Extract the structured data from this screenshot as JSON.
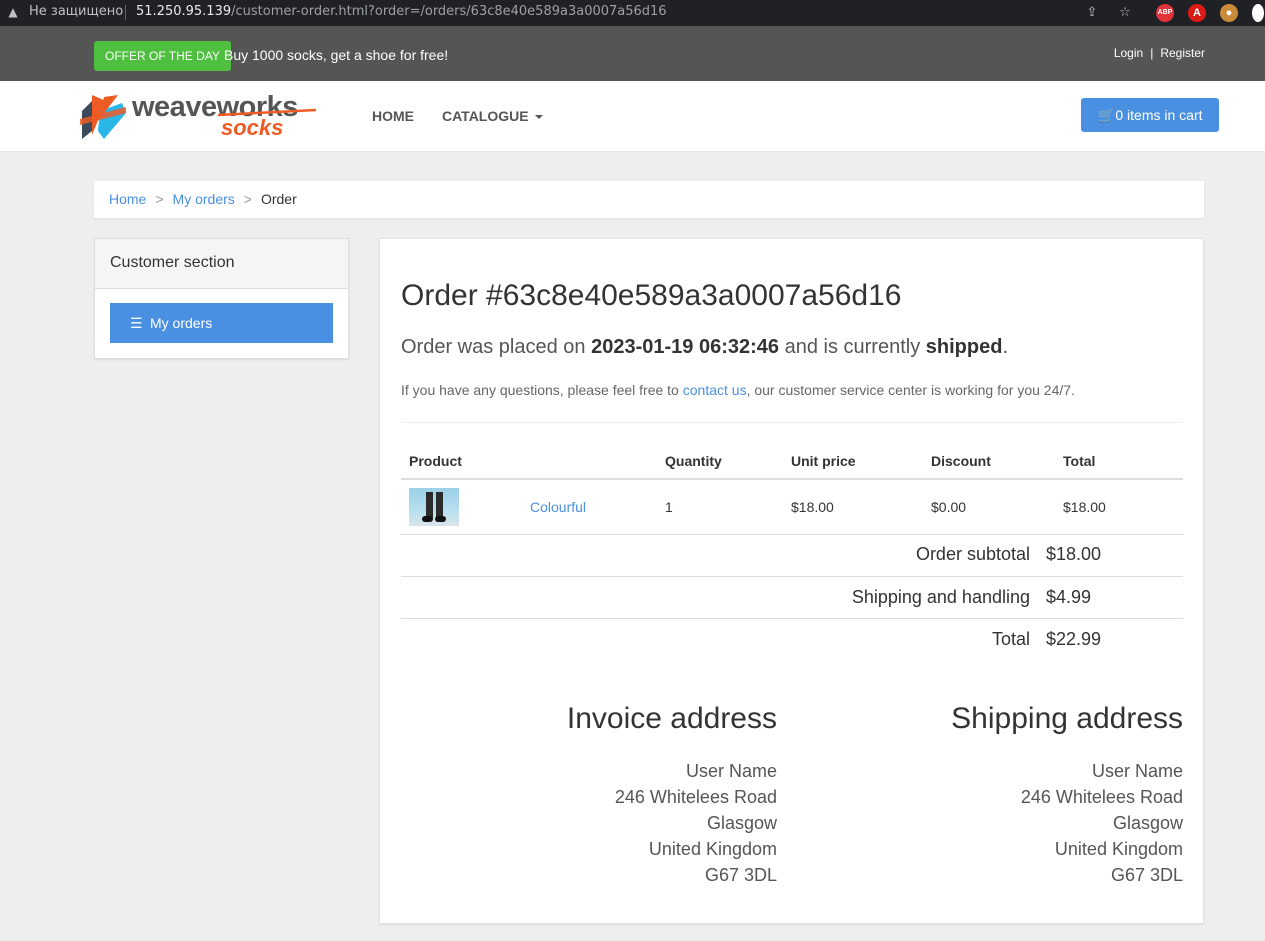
{
  "browser": {
    "insecure_label": "Не защищено",
    "url_host": "51.250.95.139",
    "url_path": "/customer-order.html?order=/orders/63c8e40e589a3a0007a56d16"
  },
  "topbar": {
    "offer_badge": "Offer of the day",
    "offer_text": "Buy 1000 socks, get a shoe for free!",
    "login": "Login",
    "separator": "|",
    "register": "Register"
  },
  "navbar": {
    "logo_main": "weaveworks",
    "logo_sub": "socks",
    "home": "Home",
    "catalogue": "Catalogue",
    "cart": "0 items in cart"
  },
  "breadcrumb": {
    "home": "Home",
    "divider": ">",
    "orders": "My orders",
    "current": "Order"
  },
  "sidebar": {
    "title": "Customer section",
    "my_orders": "My orders"
  },
  "order": {
    "title": "Order #63c8e40e589a3a0007a56d16",
    "placed_prefix": "Order was placed on ",
    "date": "2023-01-19 06:32:46",
    "status_prefix": " and is currently ",
    "status": "shipped",
    "status_suffix": ".",
    "help_prefix": "If you have any questions, please feel free to ",
    "help_link": "contact us",
    "help_suffix": ", our customer service center is working for you 24/7."
  },
  "table": {
    "headers": [
      "Product",
      "Quantity",
      "Unit price",
      "Discount",
      "Total"
    ],
    "rows": [
      {
        "name": "Colourful",
        "quantity": "1",
        "unit_price": "$18.00",
        "discount": "$0.00",
        "total": "$18.00"
      }
    ]
  },
  "totals": {
    "subtotal_label": "Order subtotal",
    "subtotal": "$18.00",
    "shipping_label": "Shipping and handling",
    "shipping": "$4.99",
    "total_label": "Total",
    "total": "$22.99"
  },
  "invoice": {
    "title": "Invoice address",
    "name": "User Name",
    "street": "246 Whitelees Road",
    "city": "Glasgow",
    "country": "United Kingdom",
    "postcode": "G67 3DL"
  },
  "shipping": {
    "title": "Shipping address",
    "name": "User Name",
    "street": "246 Whitelees Road",
    "city": "Glasgow",
    "country": "United Kingdom",
    "postcode": "G67 3DL"
  },
  "colors": {
    "accent": "#4a90e2",
    "offer_green": "#4fbf40",
    "topbar": "#555555",
    "logo_orange": "#ef5b25"
  },
  "icons": [
    "warning-icon",
    "share-icon",
    "star-icon",
    "abp-icon",
    "angular-icon",
    "cookie-icon",
    "cart-icon",
    "list-icon"
  ]
}
